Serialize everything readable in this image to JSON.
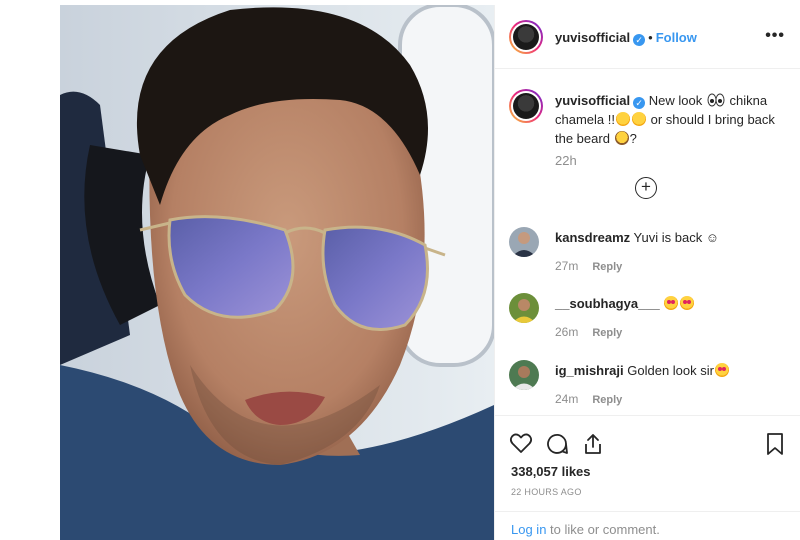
{
  "post": {
    "author": "yuvisofficial",
    "verified_mark": "✓",
    "separator": "•",
    "follow_label": "Follow",
    "more_label": "•••"
  },
  "caption": {
    "author": "yuvisofficial",
    "text_part1": "New look",
    "text_part2": "chikna chamela !!",
    "text_part3": "or should I bring back the beard",
    "text_part4": "?",
    "time": "22h"
  },
  "load_more_label": "+",
  "comments": [
    {
      "user": "kansdreamz",
      "text": "Yuvi is back ☺",
      "time": "27m",
      "reply": "Reply"
    },
    {
      "user": "__soubhagya___",
      "text": "",
      "time": "26m",
      "reply": "Reply"
    },
    {
      "user": "ig_mishraji",
      "text": "Golden look sir",
      "time": "24m",
      "reply": "Reply"
    }
  ],
  "likes": "338,057 likes",
  "posted_ago": "22 HOURS AGO",
  "login": {
    "link": "Log in",
    "suffix": " to like or comment."
  },
  "icons": [
    "heart-icon",
    "comment-icon",
    "share-icon",
    "bookmark-icon",
    "plus-circle-icon",
    "more-icon",
    "verified-icon"
  ],
  "colors": {
    "accent": "#3897f0",
    "muted": "#8e8e8e",
    "text": "#262626"
  }
}
